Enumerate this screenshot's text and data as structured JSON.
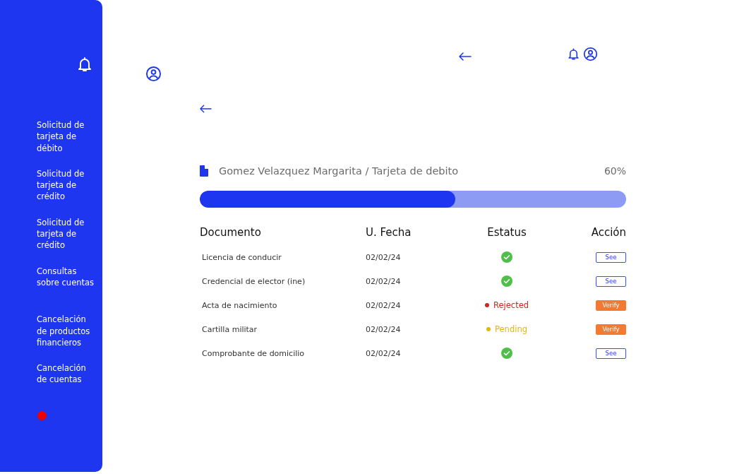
{
  "sidebar": {
    "items": [
      {
        "label": "Solicitud de tarjeta de débito"
      },
      {
        "label": "Solicitud de tarjeta de crédito"
      },
      {
        "label": "Solicitud de tarjeta de crédito"
      },
      {
        "label": "Consultas sobre cuentas"
      },
      {
        "label": "Cancelación de productos financieros"
      },
      {
        "label": "Cancelación de cuentas"
      }
    ]
  },
  "request": {
    "title": "Gomez Velazquez Margarita / Tarjeta de debito",
    "percent": "60%",
    "level": 0.6
  },
  "table": {
    "columns": [
      "Documento",
      "U. Fecha",
      "Estatus",
      "Acción"
    ],
    "rows": [
      {
        "document": "Licencia de conducir",
        "date": "02/02/24",
        "status": {
          "kind": "approved"
        },
        "action": {
          "kind": "see",
          "label": "See"
        }
      },
      {
        "document": "Credencial de elector (ine)",
        "date": "02/02/24",
        "status": {
          "kind": "approved"
        },
        "action": {
          "kind": "see",
          "label": "See"
        }
      },
      {
        "document": "Acta de nacimiento",
        "date": "02/02/24",
        "status": {
          "kind": "text",
          "label": "Rejected",
          "color": "#d42323"
        },
        "action": {
          "kind": "verify",
          "label": "Verify"
        }
      },
      {
        "document": "Cartilla militar",
        "date": "02/02/24",
        "status": {
          "kind": "text",
          "label": "Pending",
          "color": "#e6b412"
        },
        "action": {
          "kind": "verify",
          "label": "Verify"
        }
      },
      {
        "document": "Comprobante de domicilio",
        "date": "02/02/24",
        "status": {
          "kind": "approved"
        },
        "action": {
          "kind": "see",
          "label": "See"
        }
      }
    ]
  }
}
